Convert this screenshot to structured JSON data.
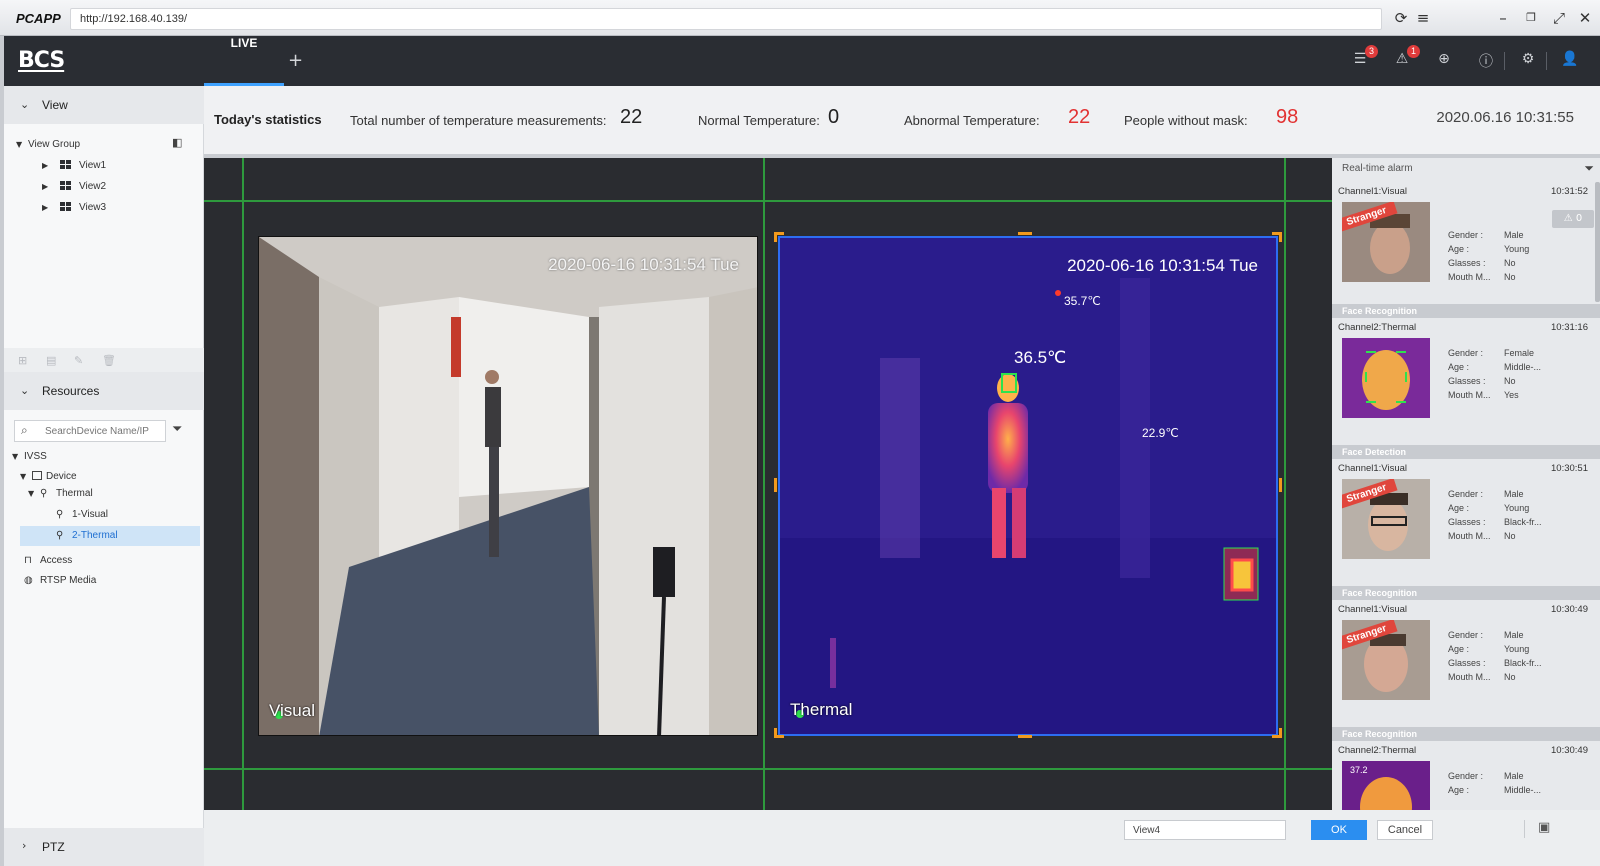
{
  "browser": {
    "app_name": "PCAPP",
    "url": "http://192.168.40.139/"
  },
  "header": {
    "logo": "BCS",
    "tabs": [
      {
        "label": "LIVE",
        "active": true
      }
    ],
    "add_tab": "+",
    "icons": [
      "event-list-icon",
      "alarm-icon",
      "network-icon",
      "info-icon",
      "settings-icon",
      "user-icon"
    ],
    "event_badge": "3",
    "alarm_badge": "1"
  },
  "sidebar": {
    "view_section": "View",
    "view_group": "View Group",
    "views": [
      "View1",
      "View2",
      "View3"
    ],
    "resources_section": "Resources",
    "search_placeholder": "SearchDevice Name/IP",
    "tree": {
      "root": "IVSS",
      "device": "Device",
      "thermal": "Thermal",
      "channels": [
        "1-Visual",
        "2-Thermal"
      ],
      "selected": "2-Thermal",
      "access": "Access",
      "rtsp": "RTSP Media"
    },
    "ptz_section": "PTZ"
  },
  "stats": {
    "title": "Today's statistics",
    "total_label": "Total number of temperature measurements:",
    "total_value": "22",
    "normal_label": "Normal Temperature:",
    "normal_value": "0",
    "abnormal_label": "Abnormal Temperature:",
    "abnormal_value": "22",
    "mask_label": "People without mask:",
    "mask_value": "98",
    "datetime": "2020.06.16 10:31:55",
    "alert_color": "#e23232"
  },
  "feeds": {
    "visual": {
      "label": "Visual",
      "osd_time": "2020-06-16 10:31:54 Tue"
    },
    "thermal": {
      "label": "Thermal",
      "osd_time": "2020-06-16 10:31:54 Tue",
      "temps": {
        "person": "36.5℃",
        "hotspot_top": "35.7℃",
        "hotspot_right": "22.9℃"
      }
    }
  },
  "alarm_panel": {
    "title": "Real-time alarm",
    "warn_count": "0",
    "attr_labels": {
      "gender": "Gender :",
      "age": "Age :",
      "glasses": "Glasses :",
      "mouth": "Mouth M..."
    },
    "cards": [
      {
        "type": "",
        "channel": "Channel1:Visual",
        "time": "10:31:52",
        "stranger": "Stranger",
        "gender": "Male",
        "age": "Young",
        "glasses": "No",
        "mouth": "No"
      },
      {
        "type": "Face Recognition",
        "channel": "Channel2:Thermal",
        "time": "10:31:16",
        "stranger": "",
        "gender": "Female",
        "age": "Middle-...",
        "glasses": "No",
        "mouth": "Yes"
      },
      {
        "type": "Face Detection",
        "channel": "Channel1:Visual",
        "time": "10:30:51",
        "stranger": "Stranger",
        "gender": "Male",
        "age": "Young",
        "glasses": "Black-fr...",
        "mouth": "No"
      },
      {
        "type": "Face Recognition",
        "channel": "Channel1:Visual",
        "time": "10:30:49",
        "stranger": "Stranger",
        "gender": "Male",
        "age": "Young",
        "glasses": "Black-fr...",
        "mouth": "No"
      },
      {
        "type": "Face Recognition",
        "channel": "Channel2:Thermal",
        "time": "10:30:49",
        "stranger": "",
        "face_temp": "37.2",
        "gender": "Male",
        "age": "Middle-...",
        "glasses": "",
        "mouth": ""
      }
    ]
  },
  "bottom": {
    "view_name": "View4",
    "ok": "OK",
    "cancel": "Cancel"
  }
}
